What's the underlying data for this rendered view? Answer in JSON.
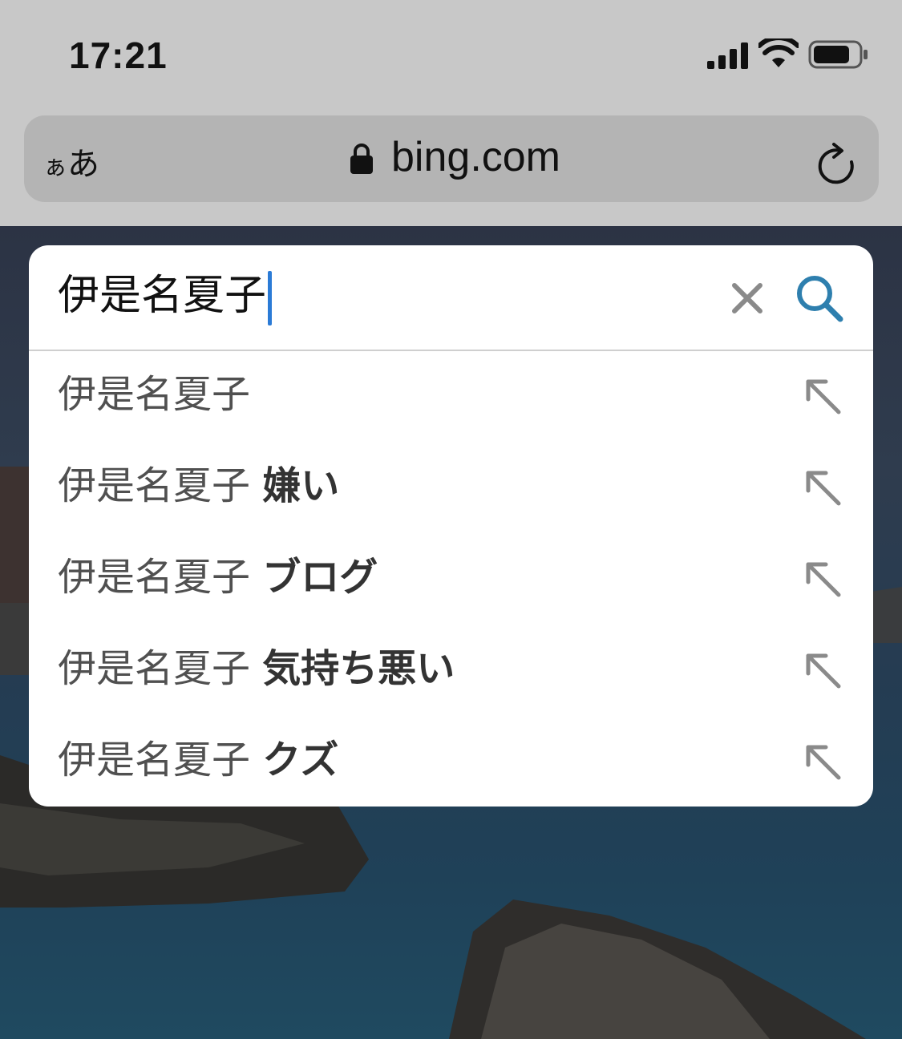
{
  "status_bar": {
    "time": "17:21",
    "icons": [
      "signal-icon",
      "wifi-icon",
      "battery-icon"
    ]
  },
  "address_bar": {
    "reader_small": "ぁ",
    "reader_large": "あ",
    "url": "bing.com",
    "icons": [
      "lock-icon",
      "reload-icon"
    ]
  },
  "search": {
    "query": "伊是名夏子",
    "icons": [
      "clear-icon",
      "search-icon"
    ],
    "accent_color": "#2e7fae",
    "caret_color": "#2b7bd6"
  },
  "suggestions": [
    {
      "base": "伊是名夏子",
      "suffix": ""
    },
    {
      "base": "伊是名夏子",
      "suffix": "嫌い"
    },
    {
      "base": "伊是名夏子",
      "suffix": "ブログ"
    },
    {
      "base": "伊是名夏子",
      "suffix": "気持ち悪い"
    },
    {
      "base": "伊是名夏子",
      "suffix": "クズ"
    }
  ]
}
